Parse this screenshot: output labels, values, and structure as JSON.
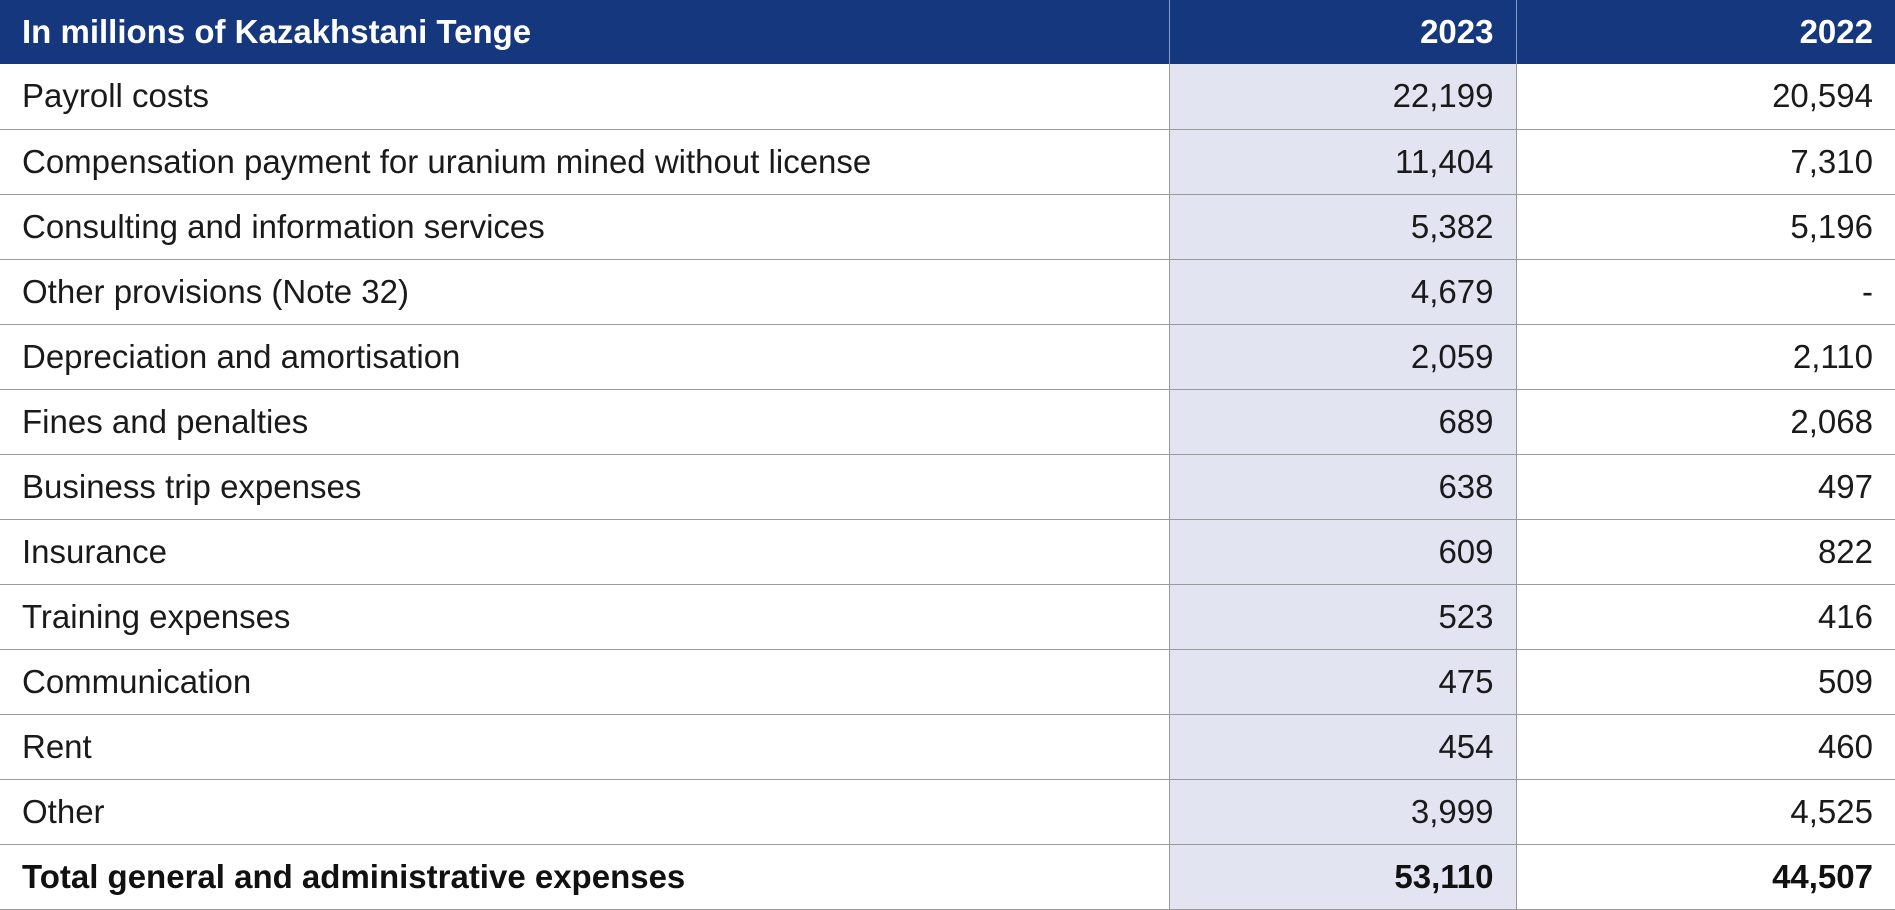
{
  "table": {
    "header": {
      "label": "In millions of Kazakhstani Tenge",
      "year1": "2023",
      "year2": "2022"
    },
    "rows": [
      {
        "label": "Payroll costs",
        "y2023": "22,199",
        "y2022": "20,594"
      },
      {
        "label": "Compensation payment for uranium mined without license",
        "y2023": "11,404",
        "y2022": "7,310"
      },
      {
        "label": "Consulting and information services",
        "y2023": "5,382",
        "y2022": "5,196"
      },
      {
        "label": "Other provisions (Note 32)",
        "y2023": "4,679",
        "y2022": "-"
      },
      {
        "label": "Depreciation and amortisation",
        "y2023": "2,059",
        "y2022": "2,110"
      },
      {
        "label": "Fines and penalties",
        "y2023": "689",
        "y2022": "2,068"
      },
      {
        "label": "Business trip expenses",
        "y2023": "638",
        "y2022": "497"
      },
      {
        "label": "Insurance",
        "y2023": "609",
        "y2022": "822"
      },
      {
        "label": "Training expenses",
        "y2023": "523",
        "y2022": "416"
      },
      {
        "label": "Communication",
        "y2023": "475",
        "y2022": "509"
      },
      {
        "label": "Rent",
        "y2023": "454",
        "y2022": "460"
      },
      {
        "label": "Other",
        "y2023": "3,999",
        "y2022": "4,525"
      }
    ],
    "total": {
      "label": "Total general and administrative expenses",
      "y2023": "53,110",
      "y2022": "44,507"
    }
  },
  "colors": {
    "header_bg": "#14377d",
    "highlight_column_bg": "#e2e4f2"
  }
}
